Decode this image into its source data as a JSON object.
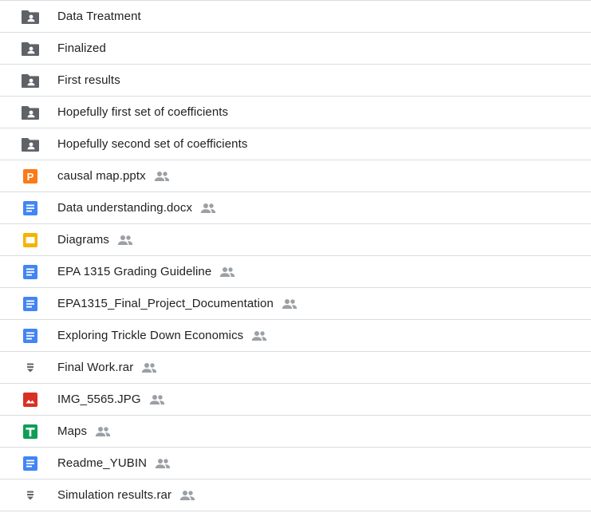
{
  "colors": {
    "folder": "#5f6368",
    "docs": "#4285f4",
    "slides": "#f4b400",
    "sheets": "#0f9d58",
    "image": "#d93025",
    "pptx": "#fa7b17",
    "archive": "#5f6368",
    "shared": "#9aa0a6"
  },
  "files": [
    {
      "name": "Data Treatment",
      "type": "shared-folder",
      "icon": "shared-folder-icon",
      "shared": false
    },
    {
      "name": "Finalized",
      "type": "shared-folder",
      "icon": "shared-folder-icon",
      "shared": false
    },
    {
      "name": "First results",
      "type": "shared-folder",
      "icon": "shared-folder-icon",
      "shared": false
    },
    {
      "name": "Hopefully first set of coefficients",
      "type": "shared-folder",
      "icon": "shared-folder-icon",
      "shared": false
    },
    {
      "name": "Hopefully second set of coefficients",
      "type": "shared-folder",
      "icon": "shared-folder-icon",
      "shared": false
    },
    {
      "name": "causal map.pptx",
      "type": "pptx",
      "icon": "powerpoint-icon",
      "shared": true
    },
    {
      "name": "Data understanding.docx",
      "type": "docs",
      "icon": "google-docs-icon",
      "shared": true
    },
    {
      "name": "Diagrams",
      "type": "slides",
      "icon": "google-slides-icon",
      "shared": true
    },
    {
      "name": "EPA 1315 Grading Guideline",
      "type": "docs",
      "icon": "google-docs-icon",
      "shared": true
    },
    {
      "name": "EPA1315_Final_Project_Documentation",
      "type": "docs",
      "icon": "google-docs-icon",
      "shared": true
    },
    {
      "name": "Exploring Trickle Down Economics",
      "type": "docs",
      "icon": "google-docs-icon",
      "shared": true
    },
    {
      "name": "Final Work.rar",
      "type": "archive",
      "icon": "archive-icon",
      "shared": true
    },
    {
      "name": "IMG_5565.JPG",
      "type": "image",
      "icon": "image-icon",
      "shared": true
    },
    {
      "name": "Maps",
      "type": "sheets",
      "icon": "google-sheets-icon",
      "shared": true
    },
    {
      "name": "Readme_YUBIN",
      "type": "docs",
      "icon": "google-docs-icon",
      "shared": true
    },
    {
      "name": "Simulation results.rar",
      "type": "archive",
      "icon": "archive-icon",
      "shared": true
    }
  ]
}
